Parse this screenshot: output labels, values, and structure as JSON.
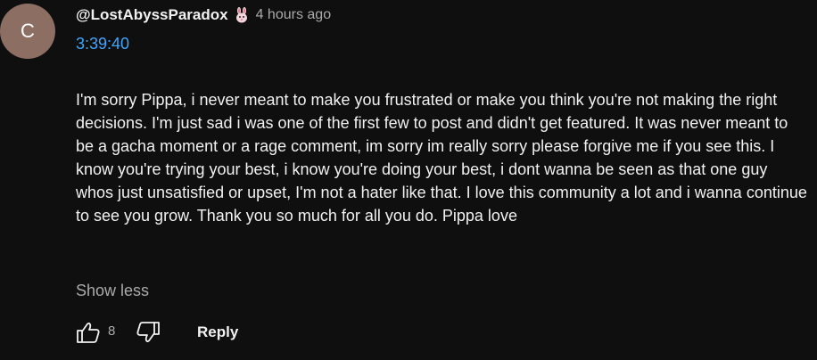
{
  "comment": {
    "avatar_letter": "C",
    "author": "@LostAbyssParadox",
    "time_ago": "4 hours ago",
    "timestamp_link": "3:39:40",
    "text": "I'm sorry Pippa, i never meant to make you frustrated or make you think you're not making the right decisions. I'm just sad i was one of the first few to post and didn't get featured. It was never meant to be a gacha moment or a rage comment, im sorry im really sorry please forgive me if you see this. I know you're trying your best, i know you're doing your best, i dont wanna be seen as that one guy whos just unsatisfied or upset, I'm not a hater like that. I love this community a lot and i wanna continue to see you grow. Thank you so much for all you do. Pippa love",
    "show_less_label": "Show less",
    "like_count": "8",
    "reply_label": "Reply"
  },
  "colors": {
    "background": "#0f0f0f",
    "avatar": "#8d6e63",
    "link": "#3ea6ff",
    "secondary_text": "#aaaaaa",
    "primary_text": "#f1f1f1"
  },
  "icons": {
    "badge": "bunny-badge-icon",
    "like": "thumbs-up-icon",
    "dislike": "thumbs-down-icon"
  }
}
